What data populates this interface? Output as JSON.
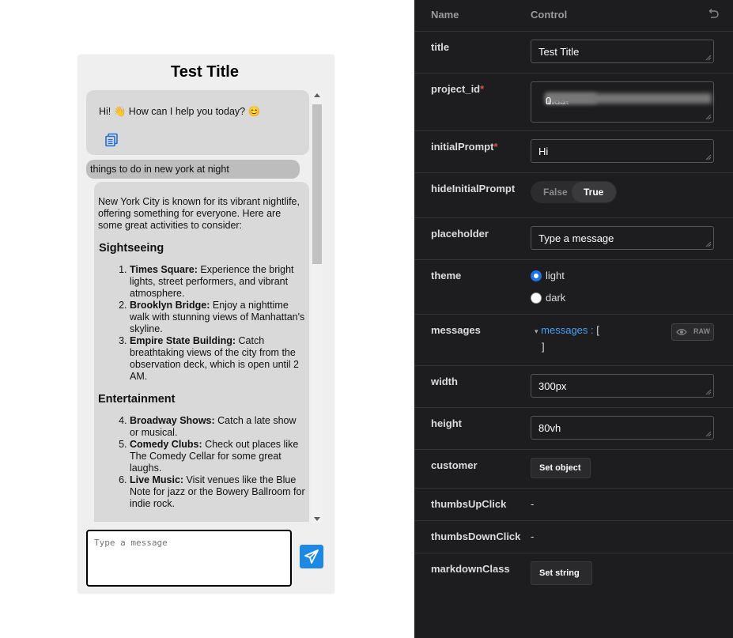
{
  "chat": {
    "title": "Test Title",
    "greeting": "Hi! 👋 How can I help you today? 😊",
    "user_message": "things to do in new york at night",
    "reply": {
      "intro": "New York City is known for its vibrant nightlife, offering something for everyone. Here are some great activities to consider:",
      "sections": [
        {
          "heading": "Sightseeing",
          "items": [
            {
              "bold": "Times Square:",
              "text": " Experience the bright lights, street performers, and vibrant atmosphere."
            },
            {
              "bold": "Brooklyn Bridge:",
              "text": " Enjoy a nighttime walk with stunning views of Manhattan's skyline."
            },
            {
              "bold": "Empire State Building:",
              "text": " Catch breathtaking views of the city from the observation deck, which is open until 2 AM."
            }
          ]
        },
        {
          "heading": "Entertainment",
          "items": [
            {
              "bold": "Broadway Shows:",
              "text": " Catch a late show or musical."
            },
            {
              "bold": "Comedy Clubs:",
              "text": " Check out places like The Comedy Cellar for some great laughs."
            },
            {
              "bold": "Live Music:",
              "text": " Visit venues like the Blue Note for jazz or the Bowery Ballroom for indie rock."
            }
          ]
        }
      ]
    },
    "input_placeholder": "Type a message"
  },
  "panel": {
    "header": {
      "name": "Name",
      "control": "Control"
    },
    "props": {
      "title": {
        "name": "title",
        "value": "Test Title"
      },
      "project_id": {
        "name": "project_id",
        "value_start": "379a",
        "value_mid": "af83-",
        "value_line2_start": "1",
        "value_line2_end": "0"
      },
      "initialPrompt": {
        "name": "initialPrompt",
        "value": "Hi"
      },
      "hideInitialPrompt": {
        "name": "hideInitialPrompt",
        "false_label": "False",
        "true_label": "True"
      },
      "placeholder": {
        "name": "placeholder",
        "value": "Type a message"
      },
      "theme": {
        "name": "theme",
        "options": [
          "light",
          "dark"
        ],
        "selected": "light"
      },
      "messages": {
        "name": "messages",
        "key": "messages",
        "colon": ":",
        "open": "[",
        "close": "]",
        "raw_label": "RAW"
      },
      "width": {
        "name": "width",
        "value": "300px"
      },
      "height": {
        "name": "height",
        "value": "80vh"
      },
      "customer": {
        "name": "customer",
        "button": "Set object"
      },
      "thumbsUpClick": {
        "name": "thumbsUpClick",
        "value": "-"
      },
      "thumbsDownClick": {
        "name": "thumbsDownClick",
        "value": "-"
      },
      "markdownClass": {
        "name": "markdownClass",
        "button": "Set string"
      }
    },
    "required_mark": "*"
  },
  "colors": {
    "accent": "#1e88e5",
    "panel_bg": "#1d1d1f",
    "required": "#e34b4b",
    "json_key": "#4a9ff5"
  }
}
